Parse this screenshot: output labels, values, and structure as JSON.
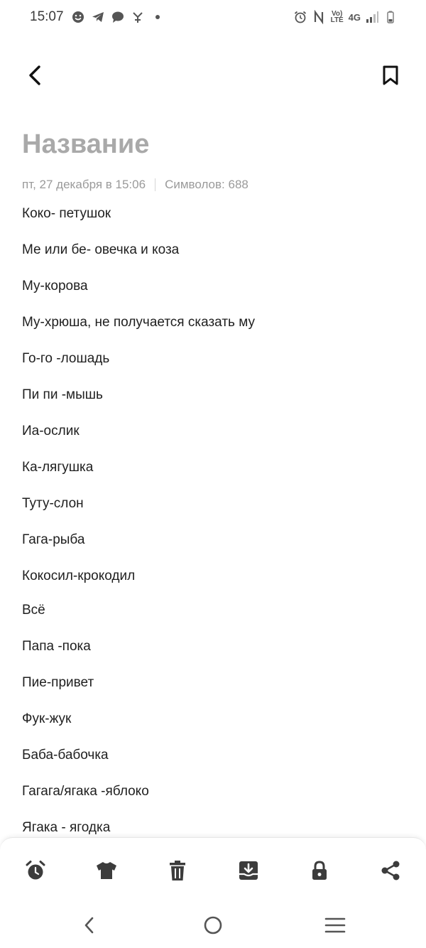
{
  "status": {
    "time": "15:07",
    "volte_label": "Vo)\nLTE",
    "network": "4G"
  },
  "note": {
    "title": "Название",
    "date": "пт, 27 декабря в 15:06",
    "char_count": "Символов: 688",
    "lines": [
      "Коко- петушок",
      "Ме или бе- овечка и коза",
      "Му-корова",
      "Му-хрюша, не получается сказать му",
      "Го-го -лошадь",
      "Пи пи -мышь",
      "Иа-ослик",
      "Ка-лягушка",
      "Туту-слон",
      "Гага-рыба",
      "Кокосил-крокодил",
      "Всё",
      "Папа -пока",
      "Пие-привет",
      "Фук-жук",
      "Баба-бабочка",
      "Гагага/ягака -яблоко",
      "Ягака - ягодка"
    ]
  },
  "toolbar": {
    "icons": [
      "alarm-icon",
      "shirt-icon",
      "trash-icon",
      "save-icon",
      "lock-icon",
      "share-icon"
    ]
  },
  "colors": {
    "title_placeholder": "#a9a9a9",
    "meta_text": "#9a9a9a",
    "icon_dark": "#3c3c3c",
    "body_text": "#1f1f1f"
  }
}
